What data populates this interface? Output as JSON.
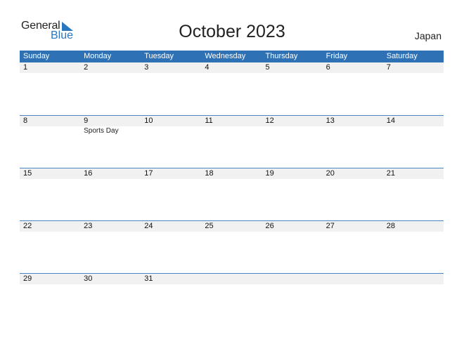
{
  "logo": {
    "general": "General",
    "blue": "Blue"
  },
  "title": "October 2023",
  "country": "Japan",
  "weekdays": [
    "Sunday",
    "Monday",
    "Tuesday",
    "Wednesday",
    "Thursday",
    "Friday",
    "Saturday"
  ],
  "weeks": [
    {
      "days": [
        "1",
        "2",
        "3",
        "4",
        "5",
        "6",
        "7"
      ],
      "events": [
        "",
        "",
        "",
        "",
        "",
        "",
        ""
      ]
    },
    {
      "days": [
        "8",
        "9",
        "10",
        "11",
        "12",
        "13",
        "14"
      ],
      "events": [
        "",
        "Sports Day",
        "",
        "",
        "",
        "",
        ""
      ]
    },
    {
      "days": [
        "15",
        "16",
        "17",
        "18",
        "19",
        "20",
        "21"
      ],
      "events": [
        "",
        "",
        "",
        "",
        "",
        "",
        ""
      ]
    },
    {
      "days": [
        "22",
        "23",
        "24",
        "25",
        "26",
        "27",
        "28"
      ],
      "events": [
        "",
        "",
        "",
        "",
        "",
        "",
        ""
      ]
    },
    {
      "days": [
        "29",
        "30",
        "31",
        "",
        "",
        "",
        ""
      ],
      "events": [
        "",
        "",
        "",
        "",
        "",
        "",
        ""
      ]
    }
  ],
  "colors": {
    "header": "#2e72b5",
    "brand_blue": "#2a76bf",
    "day_strip": "#f1f1f1"
  }
}
